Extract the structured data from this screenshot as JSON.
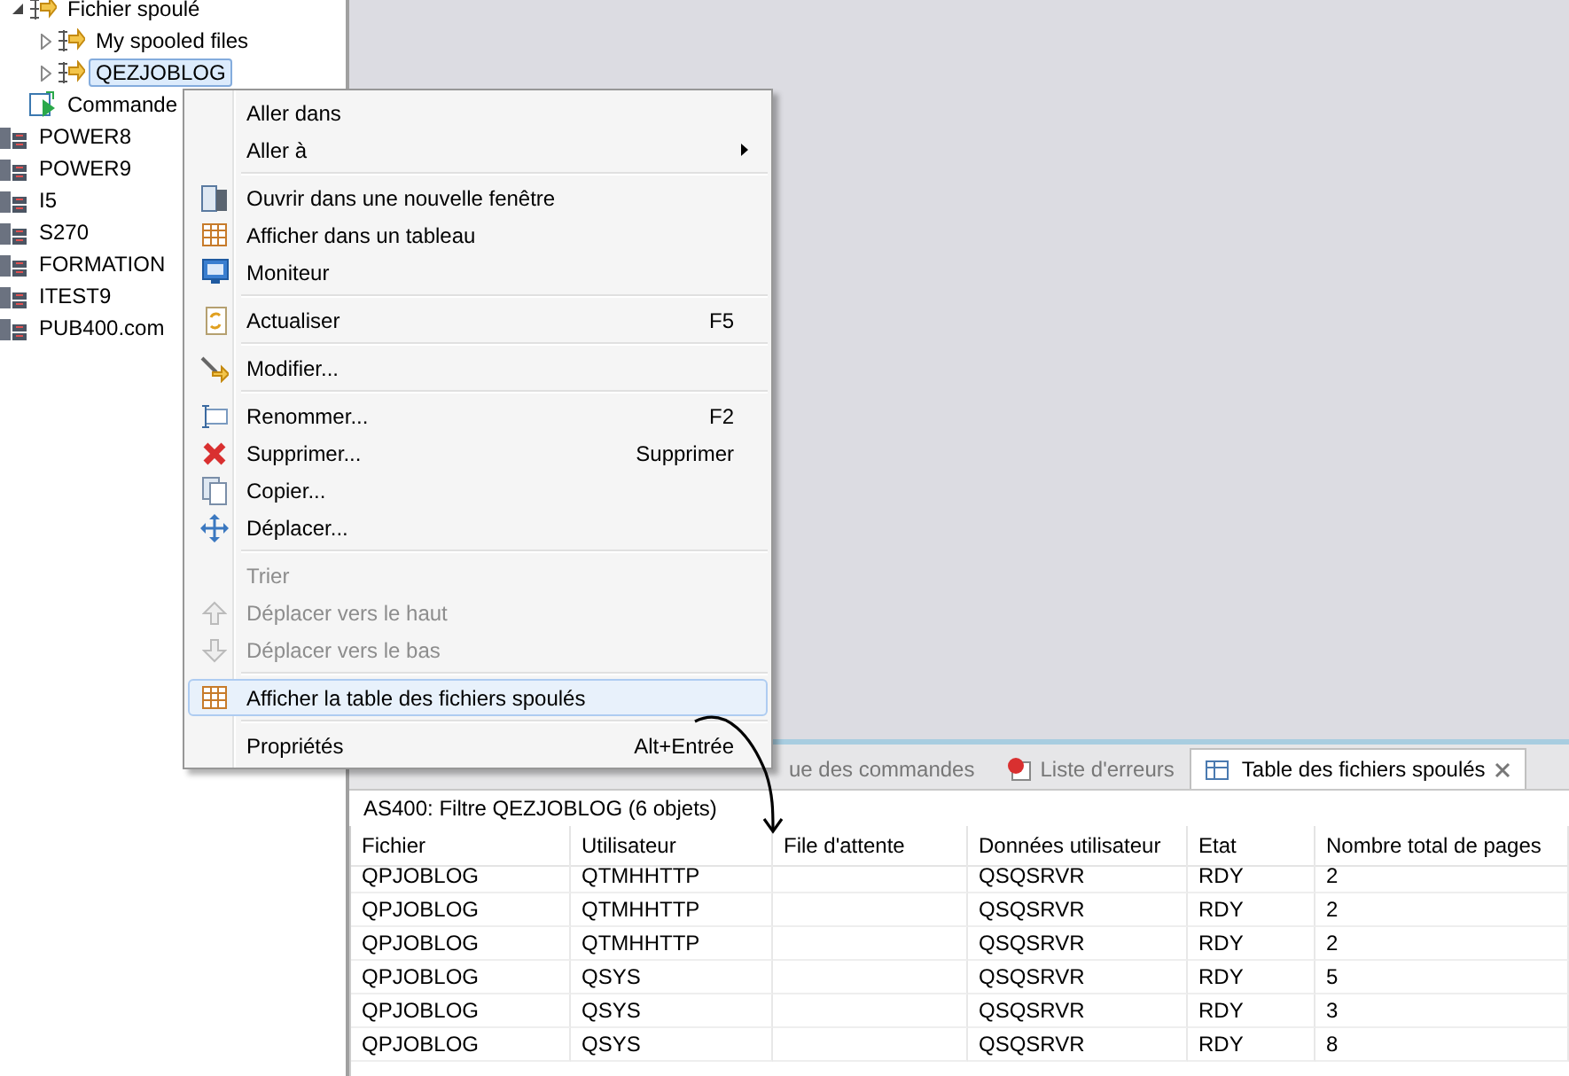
{
  "tree": {
    "partial_children": [
      {
        "label": "Fichier spoulé",
        "expanded": true,
        "selected": false,
        "children": [
          {
            "label": "My spooled files",
            "expanded": false,
            "selected": false
          },
          {
            "label": "QEZJOBLOG",
            "expanded": false,
            "selected": true
          }
        ]
      },
      {
        "label": "Commande",
        "selected": false
      }
    ],
    "items": [
      {
        "label": "POWER8",
        "selected": false
      },
      {
        "label": "POWER9",
        "selected": false
      },
      {
        "label": "I5",
        "selected": false
      },
      {
        "label": "S270",
        "selected": false
      },
      {
        "label": "FORMATION",
        "selected": false
      },
      {
        "label": "ITEST9",
        "selected": false
      },
      {
        "label": "PUB400.com",
        "selected": false
      }
    ]
  },
  "context_menu": {
    "items": [
      {
        "kind": "item",
        "label": "Aller dans",
        "disabled": false,
        "selected": false
      },
      {
        "kind": "item",
        "label": "Aller à",
        "submenu": true,
        "disabled": false,
        "selected": false
      },
      {
        "kind": "separator"
      },
      {
        "kind": "item",
        "label": "Ouvrir dans une nouvelle fenêtre",
        "disabled": false,
        "selected": false
      },
      {
        "kind": "item",
        "label": "Afficher dans un tableau",
        "disabled": false,
        "selected": false
      },
      {
        "kind": "item",
        "label": "Moniteur",
        "disabled": false,
        "selected": false
      },
      {
        "kind": "separator"
      },
      {
        "kind": "item",
        "label": "Actualiser",
        "shortcut": "F5",
        "disabled": false,
        "selected": false
      },
      {
        "kind": "separator"
      },
      {
        "kind": "item",
        "label": "Modifier...",
        "disabled": false,
        "selected": false
      },
      {
        "kind": "separator"
      },
      {
        "kind": "item",
        "label": "Renommer...",
        "shortcut": "F2",
        "disabled": false,
        "selected": false
      },
      {
        "kind": "item",
        "label": "Supprimer...",
        "shortcut": "Supprimer",
        "disabled": false,
        "selected": false
      },
      {
        "kind": "item",
        "label": "Copier...",
        "disabled": false,
        "selected": false
      },
      {
        "kind": "item",
        "label": "Déplacer...",
        "disabled": false,
        "selected": false
      },
      {
        "kind": "separator"
      },
      {
        "kind": "item",
        "label": "Trier",
        "disabled": true,
        "selected": false
      },
      {
        "kind": "item",
        "label": "Déplacer vers le haut",
        "disabled": true,
        "selected": false
      },
      {
        "kind": "item",
        "label": "Déplacer vers le bas",
        "disabled": true,
        "selected": false
      },
      {
        "kind": "separator"
      },
      {
        "kind": "item",
        "label": "Afficher la table des fichiers spoulés",
        "disabled": false,
        "selected": true
      },
      {
        "kind": "separator"
      },
      {
        "kind": "item",
        "label": "Propriétés",
        "shortcut": "Alt+Entrée",
        "disabled": false,
        "selected": false
      }
    ]
  },
  "bottom_panel": {
    "tabs": [
      {
        "label": "ue des commandes",
        "selected": false
      },
      {
        "label": "Liste d'erreurs",
        "selected": false
      },
      {
        "label": "Table des fichiers spoulés",
        "selected": true,
        "closable": true
      }
    ],
    "filter_label": "AS400: Filtre  QEZJOBLOG  (6 objets)",
    "table": {
      "columns": [
        "Fichier",
        "Utilisateur",
        "File d'attente",
        "Données utilisateur",
        "Etat",
        "Nombre total de pages"
      ],
      "rows": [
        [
          "QPJOBLOG",
          "QTMHHTTP",
          "",
          "QSQSRVR",
          "RDY",
          "2"
        ],
        [
          "QPJOBLOG",
          "QTMHHTTP",
          "",
          "QSQSRVR",
          "RDY",
          "2"
        ],
        [
          "QPJOBLOG",
          "QTMHHTTP",
          "",
          "QSQSRVR",
          "RDY",
          "2"
        ],
        [
          "QPJOBLOG",
          "QSYS",
          "",
          "QSQSRVR",
          "RDY",
          "5"
        ],
        [
          "QPJOBLOG",
          "QSYS",
          "",
          "QSQSRVR",
          "RDY",
          "3"
        ],
        [
          "QPJOBLOG",
          "QSYS",
          "",
          "QSQSRVR",
          "RDY",
          "8"
        ]
      ]
    }
  }
}
